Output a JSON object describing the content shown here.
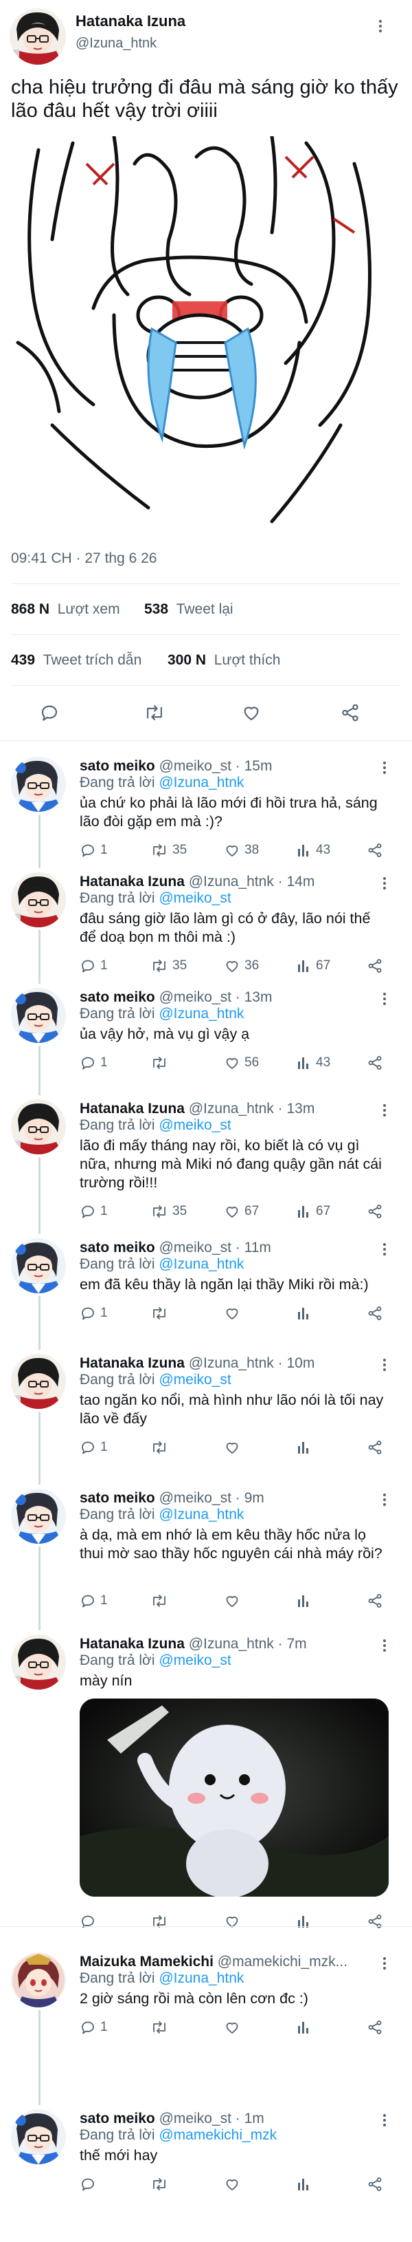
{
  "main_tweet": {
    "author_name": "Hatanaka Izuna",
    "author_handle": "@Izuna_htnk",
    "text": "cha hiệu trưởng đi đâu mà sáng giờ ko thấy lão đâu hết vậy trời ơiiii",
    "time": "09:41 CH · 27 thg 6 26",
    "views_value": "868 N",
    "views_label": "Lượt xem",
    "retweets_value": "538",
    "retweets_label": "Tweet lại",
    "quotes_value": "439",
    "quotes_label": "Tweet trích dẫn",
    "likes_value": "300 N",
    "likes_label": "Lượt thích"
  },
  "replies": [
    {
      "name": "sato meiko",
      "handle": "@meiko_st",
      "time": "· 15m",
      "reply_prefix": "Đang trả lời",
      "reply_to": "@Izuna_htnk",
      "text": "ủa chứ ko phải là lão mới đi hồi trưa hả, sáng lão đòi gặp em mà :)?",
      "replies": "1",
      "retweets": "35",
      "likes": "38",
      "views": "43"
    },
    {
      "name": "Hatanaka Izuna",
      "handle": "@Izuna_htnk",
      "time": "· 14m",
      "reply_prefix": "Đang trả lời",
      "reply_to": "@meiko_st",
      "text": "đâu sáng giờ lão làm gì có ở đây, lão nói thế để doạ bọn m thôi mà :)",
      "replies": "1",
      "retweets": "35",
      "likes": "36",
      "views": "67"
    },
    {
      "name": "sato meiko",
      "handle": "@meiko_st",
      "time": "· 13m",
      "reply_prefix": "Đang trả lời",
      "reply_to": "@Izuna_htnk",
      "text": "ủa vậy hở, mà vụ gì vậy ạ",
      "replies": "1",
      "retweets": "",
      "likes": "56",
      "views": "43"
    },
    {
      "name": "Hatanaka Izuna",
      "handle": "@Izuna_htnk",
      "time": "· 13m",
      "reply_prefix": "Đang trả lời",
      "reply_to": "@meiko_st",
      "text": "lão đi mấy tháng nay rồi, ko biết là có vụ gì nữa, nhưng mà Miki nó đang quậy gần nát cái trường rồi!!!",
      "replies": "1",
      "retweets": "35",
      "likes": "67",
      "views": "67"
    },
    {
      "name": "sato meiko",
      "handle": "@meiko_st",
      "time": "· 11m",
      "reply_prefix": "Đang trả lời",
      "reply_to": "@Izuna_htnk",
      "text": "em đã kêu thầy là ngăn lại thầy Miki rồi mà:)",
      "replies": "1",
      "retweets": "",
      "likes": "",
      "views": ""
    },
    {
      "name": "Hatanaka Izuna",
      "handle": "@Izuna_htnk",
      "time": "· 10m",
      "reply_prefix": "Đang trả lời",
      "reply_to": "@meiko_st",
      "text": "tao ngăn ko nổi, mà hình như lão nói là tối nay lão về đấy",
      "replies": "1",
      "retweets": "",
      "likes": "",
      "views": ""
    },
    {
      "name": "sato meiko",
      "handle": "@meiko_st",
      "time": "· 9m",
      "reply_prefix": "Đang trả lời",
      "reply_to": "@Izuna_htnk",
      "text": "à dạ, mà em nhớ là em kêu thầy hốc nửa lọ thui mờ sao thầy hốc nguyên cái nhà máy rồi?",
      "replies": "1",
      "retweets": "",
      "likes": "",
      "views": ""
    },
    {
      "name": "Hatanaka Izuna",
      "handle": "@Izuna_htnk",
      "time": "· 7m",
      "reply_prefix": "Đang trả lời",
      "reply_to": "@meiko_st",
      "text": "mày nín",
      "replies": "",
      "retweets": "",
      "likes": "",
      "views": ""
    },
    {
      "name": "Maizuka Mamekichi",
      "handle": "@mamekichi_mzk...",
      "time": "",
      "reply_prefix": "Đang trả lời",
      "reply_to": "@Izuna_htnk",
      "text": "2 giờ sáng rồi mà còn lên cơn đc :)",
      "replies": "1",
      "retweets": "",
      "likes": "",
      "views": ""
    },
    {
      "name": "sato meiko",
      "handle": "@meiko_st",
      "time": "· 1m",
      "reply_prefix": "Đang trả lời",
      "reply_to": "@mamekichi_mzk",
      "text": "thế mới hay",
      "replies": "",
      "retweets": "",
      "likes": "",
      "views": ""
    }
  ],
  "icons": [
    "reply-icon",
    "retweet-icon",
    "like-icon",
    "share-icon",
    "views-icon",
    "more-icon"
  ],
  "colors": {
    "link": "#1d9bf0",
    "muted": "#536471",
    "text": "#0f1419",
    "divider": "#e6ecf0"
  }
}
